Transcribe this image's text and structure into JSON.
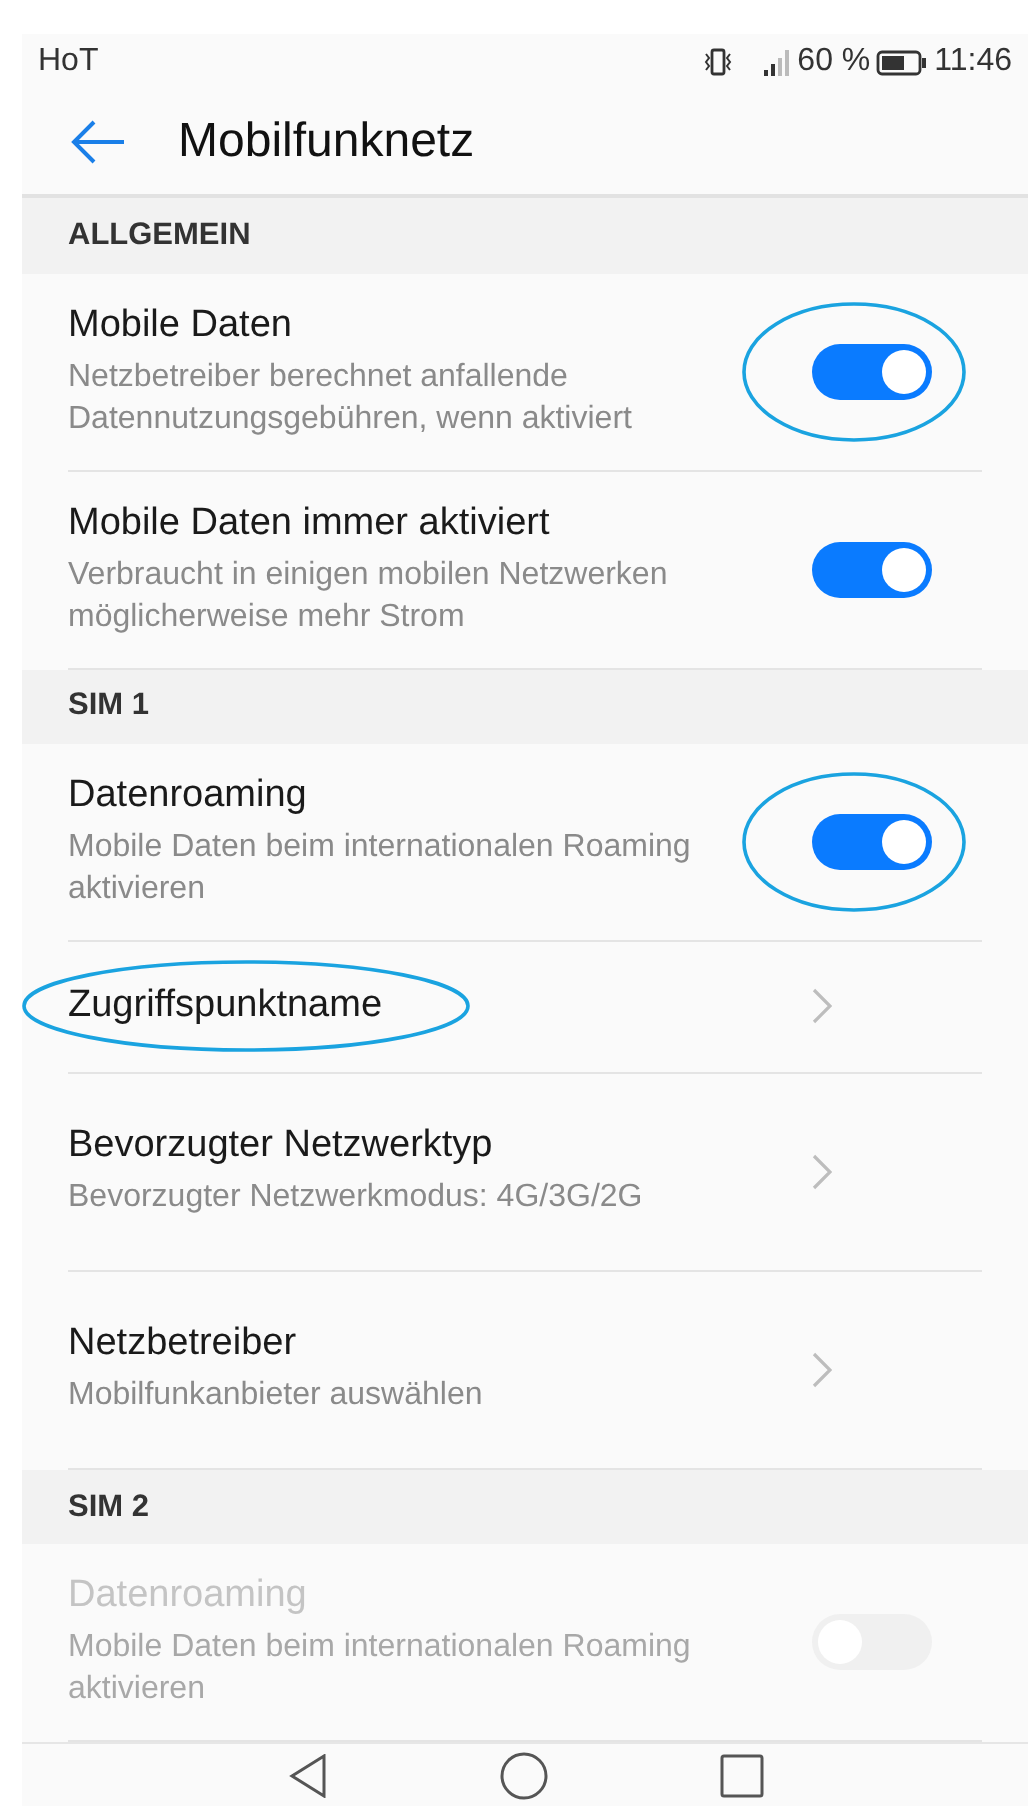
{
  "status_bar": {
    "carrier": "HoT",
    "battery": "60 %",
    "time": "11:46"
  },
  "header": {
    "title": "Mobilfunknetz"
  },
  "sections": [
    {
      "title": "ALLGEMEIN",
      "items": [
        {
          "kind": "toggle",
          "title": "Mobile Daten",
          "subtitle": "Netzbetreiber berechnet anfallende Datennutzungsgebühren, wenn aktiviert",
          "on": true,
          "disabled": false,
          "toggle_circled": true
        },
        {
          "kind": "toggle",
          "title": "Mobile Daten immer aktiviert",
          "subtitle": "Verbraucht in einigen mobilen Netzwerken möglicherweise mehr Strom",
          "on": true,
          "disabled": false
        }
      ]
    },
    {
      "title": "SIM 1",
      "items": [
        {
          "kind": "toggle",
          "title": "Datenroaming",
          "subtitle": "Mobile Daten beim internationalen Roaming aktivieren",
          "on": true,
          "disabled": false,
          "toggle_circled": true
        },
        {
          "kind": "link",
          "title": "Zugriffspunktname",
          "title_circled": true
        },
        {
          "kind": "link",
          "title": "Bevorzugter Netzwerktyp",
          "subtitle": "Bevorzugter Netzwerkmodus: 4G/3G/2G"
        },
        {
          "kind": "link",
          "title": "Netzbetreiber",
          "subtitle": "Mobilfunkanbieter auswählen"
        }
      ]
    },
    {
      "title": "SIM 2",
      "items": [
        {
          "kind": "toggle",
          "title": "Datenroaming",
          "subtitle": "Mobile Daten beim internationalen Roaming aktivieren",
          "on": false,
          "disabled": true
        }
      ]
    }
  ]
}
